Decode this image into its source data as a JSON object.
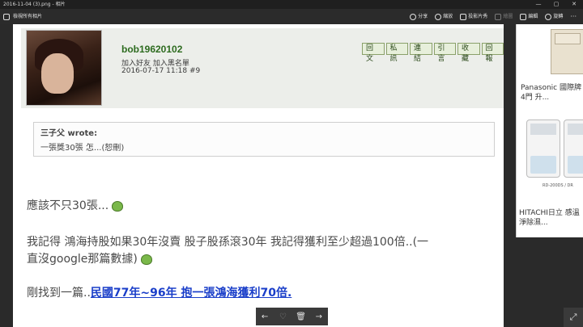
{
  "window": {
    "title": "2016-11-04 (3).png - 相片"
  },
  "toolbar": {
    "back_label": "檢視所有相片",
    "actions": [
      {
        "label": "分享",
        "icon": "share-icon",
        "enabled": true
      },
      {
        "label": "縮放",
        "icon": "zoom-icon",
        "enabled": true
      },
      {
        "label": "投影片秀",
        "icon": "slideshow-icon",
        "enabled": true
      },
      {
        "label": "繪圖",
        "icon": "draw-icon",
        "enabled": false
      },
      {
        "label": "編輯",
        "icon": "edit-icon",
        "enabled": true
      },
      {
        "label": "旋轉",
        "icon": "rotate-icon",
        "enabled": true
      }
    ]
  },
  "post": {
    "username": "bob19620102",
    "userlinks": "加入好友  加入黑名單",
    "date": "2016-07-17 11:18  #9",
    "buttons": [
      "回文",
      "私訊",
      "連結",
      "引言",
      "收藏",
      "回報"
    ],
    "quote_author": "三子父 wrote:",
    "quote_text": "一張獎30張 怎...(恕刪)",
    "line1": "應該不只30張...",
    "line2a": "我記得 鴻海持股如果30年沒賣 股子股孫滾30年 我記得獲利至少超過100倍..(一",
    "line2b": "直沒google那篇數據)",
    "line3_prefix": "剛找到一篇..",
    "line3_link": "民國77年~96年 抱一張鴻海獲利70倍."
  },
  "sidebar_ad": {
    "item1_title": "Panasonic 國際牌4門 升...",
    "item2_model": "RD-200DS / DR",
    "item2_title": "HITACHI日立 感溫 淨除濕..."
  },
  "colors": {
    "username": "#2d6b1f",
    "link": "#1a3ec9",
    "button_bg": "#e7efdb"
  }
}
